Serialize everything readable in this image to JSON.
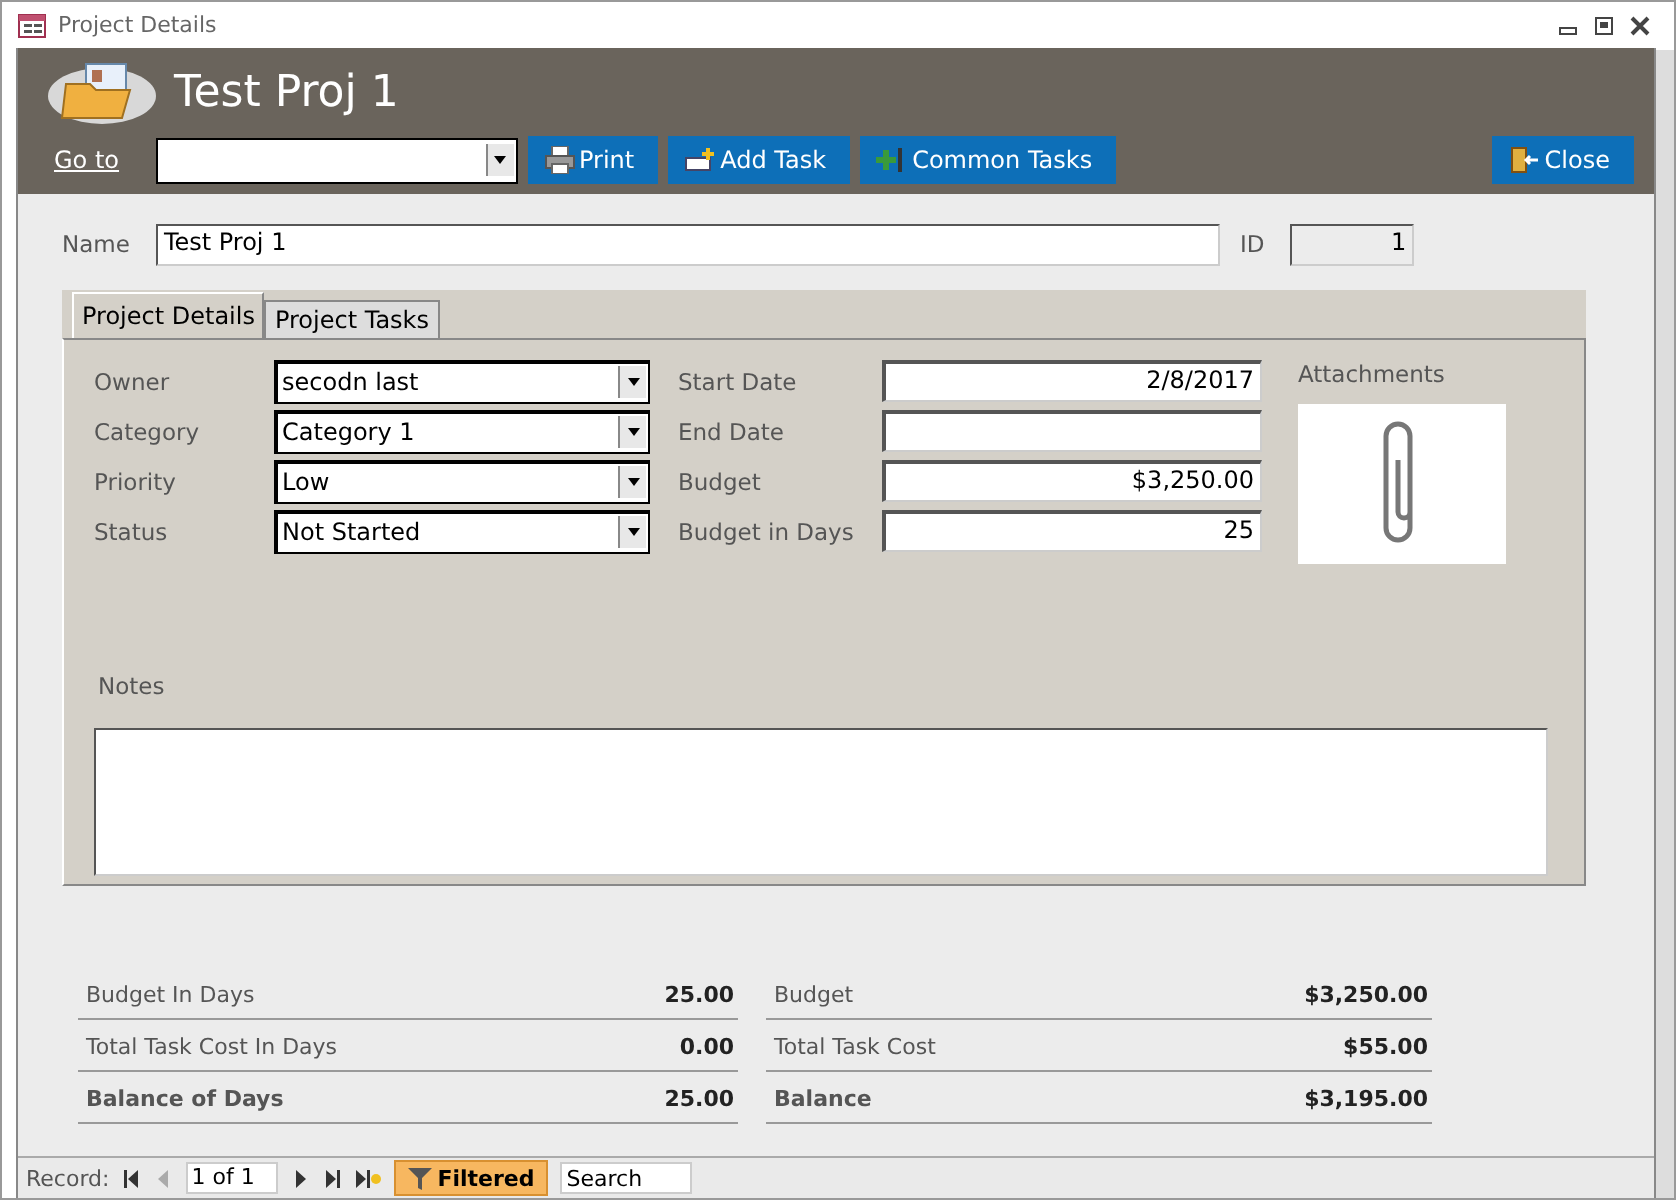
{
  "window": {
    "title": "Project Details"
  },
  "header": {
    "title": "Test Proj 1",
    "goto_label": "Go to",
    "buttons": [
      {
        "label": "Print",
        "kind": "print"
      },
      {
        "label": "Add Task",
        "kind": "add"
      },
      {
        "label": "Common Tasks",
        "kind": "common"
      }
    ],
    "close_button": {
      "label": "Close"
    }
  },
  "name_field": {
    "label": "Name",
    "value": "Test Proj 1"
  },
  "id_field": {
    "label": "ID",
    "value": "1"
  },
  "tabs": [
    {
      "label": "Project Details",
      "selected": true
    },
    {
      "label": "Project Tasks",
      "selected": false
    }
  ],
  "left_fields": [
    {
      "label": "Owner",
      "value": "secodn last"
    },
    {
      "label": "Category",
      "value": "Category 1"
    },
    {
      "label": "Priority",
      "value": "Low"
    },
    {
      "label": "Status",
      "value": "Not Started"
    }
  ],
  "right_fields": [
    {
      "label": "Start Date",
      "value": "2/8/2017"
    },
    {
      "label": "End Date"
    },
    {
      "label": "Budget",
      "value": "$3,250.00"
    },
    {
      "label": "Budget in Days",
      "value": "25"
    }
  ],
  "attachments": {
    "label": "Attachments"
  },
  "notes": {
    "label": "Notes"
  },
  "summary_left": [
    {
      "label": "Budget In Days",
      "value": "25.00",
      "bold": false
    },
    {
      "label": "Total Task Cost In Days",
      "value": "0.00",
      "bold": false
    },
    {
      "label": "Balance of Days",
      "value": "25.00",
      "bold": true
    }
  ],
  "summary_right": [
    {
      "label": "Budget",
      "value": "$3,250.00",
      "bold": false
    },
    {
      "label": "Total Task Cost",
      "value": "$55.00",
      "bold": false
    },
    {
      "label": "Balance",
      "value": "$3,195.00",
      "bold": true
    }
  ],
  "record_nav": {
    "label": "Record:",
    "position": "1 of 1",
    "filter": "Filtered",
    "search_placeholder": "Search",
    "buttons": [
      {
        "kind": "first",
        "disabled": false
      },
      {
        "kind": "prev",
        "disabled": true
      },
      {
        "kind": "next",
        "disabled": false
      },
      {
        "kind": "last",
        "disabled": false
      },
      {
        "kind": "new",
        "disabled": false
      }
    ]
  }
}
